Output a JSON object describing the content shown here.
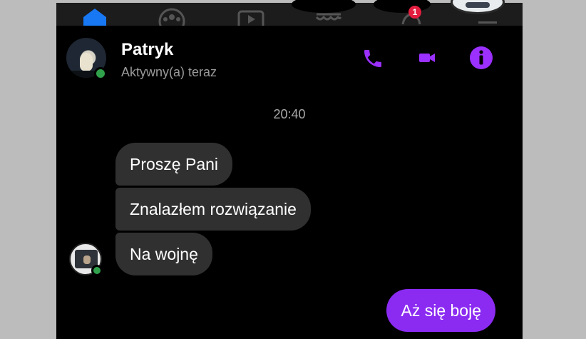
{
  "topbar": {
    "notification_count": "1",
    "icons": [
      "home-icon",
      "groups-icon",
      "watch-icon",
      "marketplace-icon",
      "notifications-icon",
      "menu-icon"
    ]
  },
  "header": {
    "contact_name": "Patryk",
    "status": "Aktywny(a) teraz",
    "actions": [
      "phone-icon",
      "video-call-icon",
      "info-icon"
    ]
  },
  "conversation": {
    "timestamp": "20:40",
    "incoming": [
      {
        "text": "Proszę Pani"
      },
      {
        "text": "Znalazłem rozwiązanie"
      },
      {
        "text": "Na wojnę"
      }
    ],
    "outgoing": [
      {
        "text": "Aż się boję"
      }
    ]
  },
  "colors": {
    "accent": "#8b2bf2",
    "incoming_bubble": "#303030",
    "online": "#31a24c",
    "background": "#000000"
  }
}
